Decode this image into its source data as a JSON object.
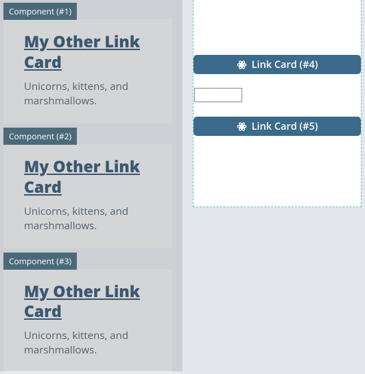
{
  "components": [
    {
      "tag": "Component (#1)",
      "title": "My Other Link Card",
      "desc": "Unicorns, kittens, and marshmallows."
    },
    {
      "tag": "Component (#2)",
      "title": "My Other Link Card",
      "desc": "Unicorns, kittens, and marshmallows."
    },
    {
      "tag": "Component (#3)",
      "title": "My Other Link Card",
      "desc": "Unicorns, kittens, and marshmallows."
    }
  ],
  "right": {
    "link4": "Link Card (#4)",
    "link5": "Link Card (#5)",
    "input_value": ""
  },
  "colors": {
    "tag_bg": "#4a6a7a",
    "btn_bg": "#3b6a8a",
    "title": "#2b4e6b"
  }
}
